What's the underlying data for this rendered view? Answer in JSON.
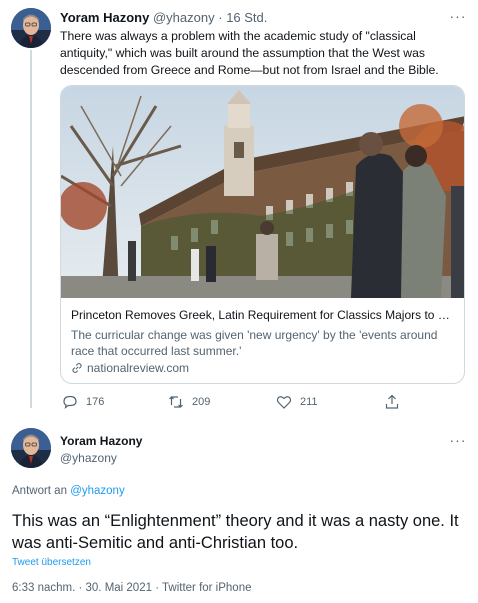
{
  "tweet1": {
    "author_name": "Yoram Hazony",
    "author_handle": "@yhazony",
    "separator": "·",
    "time": "16 Std.",
    "text": "There was always a problem with the academic study of \"classical antiquity,\" which was built around the assumption that the West was descended from Greece and Rome—but not from Israel and the Bible.",
    "more_icon": "more-horizontal-icon",
    "card": {
      "title": "Princeton Removes Greek, Latin Requirement for Classics Majors to Co...",
      "description": "The curricular change was given 'new urgency' by the 'events around race that occurred last summer.'",
      "domain": "nationalreview.com",
      "link_icon": "link-icon"
    },
    "actions": {
      "reply_count": "176",
      "retweet_count": "209",
      "like_count": "211"
    }
  },
  "tweet2": {
    "author_name": "Yoram Hazony",
    "author_handle": "@yhazony",
    "reply_prefix": "Antwort an",
    "reply_target": "@yhazony",
    "text": "This was an “Enlightenment” theory and it was a nasty one. It was anti-Semitic and anti-Christian too.",
    "translate_label": "Tweet übersetzen",
    "timestamp": "6:33 nachm. · 30. Mai 2021 · Twitter for iPhone"
  },
  "colors": {
    "accent": "#1d9bf0",
    "muted": "#536471",
    "border": "#cfd9de",
    "text": "#0f1419"
  }
}
